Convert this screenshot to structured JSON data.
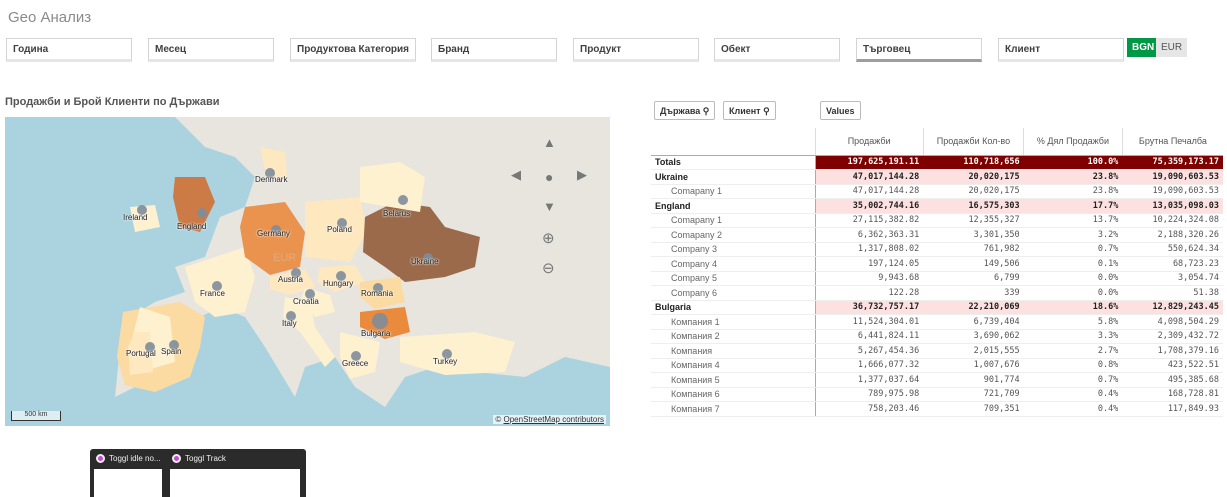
{
  "app": {
    "title": "Geo Анализ"
  },
  "filters": [
    "Година",
    "Месец",
    "Продуктова Категория",
    "Бранд",
    "Продукт",
    "Обект",
    "Търговец",
    "Клиент"
  ],
  "currency": {
    "bgn": "BGN",
    "eur": "EUR"
  },
  "map": {
    "title": "Продажби и Брой Клиенти по Държави",
    "scale": "500 km",
    "attribution_prefix": "©",
    "attribution_link": "OpenStreetMap contributors",
    "watermark": "EUR",
    "countries": [
      "Denmark",
      "Ireland",
      "England",
      "Germany",
      "Poland",
      "Belarus",
      "Ukraine",
      "Austria",
      "Hungary",
      "Romania",
      "France",
      "Croatia",
      "Italy",
      "Bulgaria",
      "Portugal",
      "Spain",
      "Greece",
      "Turkey"
    ]
  },
  "table": {
    "dims": [
      "Държава",
      "Клиент"
    ],
    "values_btn": "Values",
    "headers": [
      "Продажби",
      "Продажби Кол-во",
      "% Дял Продажби",
      "Брутна Печалба"
    ],
    "rows": [
      {
        "type": "tot",
        "cells": [
          "Totals",
          "197,625,191.11",
          "110,718,656",
          "100.0%",
          "75,359,173.17"
        ]
      },
      {
        "type": "grp",
        "cells": [
          "Ukraine",
          "47,017,144.28",
          "20,020,175",
          "23.8%",
          "19,090,603.53"
        ]
      },
      {
        "type": "sub",
        "cells": [
          "Comapany 1",
          "47,017,144.28",
          "20,020,175",
          "23.8%",
          "19,090,603.53"
        ]
      },
      {
        "type": "grp",
        "cells": [
          "England",
          "35,002,744.16",
          "16,575,303",
          "17.7%",
          "13,035,098.03"
        ]
      },
      {
        "type": "sub",
        "cells": [
          "Comapany 1",
          "27,115,382.82",
          "12,355,327",
          "13.7%",
          "10,224,324.08"
        ]
      },
      {
        "type": "sub",
        "cells": [
          "Comapany 2",
          "6,362,363.31",
          "3,301,350",
          "3.2%",
          "2,188,320.26"
        ]
      },
      {
        "type": "sub",
        "cells": [
          "Company 3",
          "1,317,808.02",
          "761,982",
          "0.7%",
          "550,624.34"
        ]
      },
      {
        "type": "sub",
        "cells": [
          "Company 4",
          "197,124.05",
          "149,506",
          "0.1%",
          "68,723.23"
        ]
      },
      {
        "type": "sub",
        "cells": [
          "Company 5",
          "9,943.68",
          "6,799",
          "0.0%",
          "3,054.74"
        ]
      },
      {
        "type": "sub",
        "cells": [
          "Company 6",
          "122.28",
          "339",
          "0.0%",
          "51.38"
        ]
      },
      {
        "type": "grp",
        "cells": [
          "Bulgaria",
          "36,732,757.17",
          "22,210,069",
          "18.6%",
          "12,829,243.45"
        ]
      },
      {
        "type": "sub",
        "cells": [
          "Компания 1",
          "11,524,304.01",
          "6,739,404",
          "5.8%",
          "4,098,504.29"
        ]
      },
      {
        "type": "sub",
        "cells": [
          "Компания 2",
          "6,441,824.11",
          "3,690,062",
          "3.3%",
          "2,309,432.72"
        ]
      },
      {
        "type": "sub",
        "cells": [
          "Компания",
          "5,267,454.36",
          "2,015,555",
          "2.7%",
          "1,708,379.16"
        ]
      },
      {
        "type": "sub",
        "cells": [
          "Компания 4",
          "1,666,077.32",
          "1,007,676",
          "0.8%",
          "423,522.51"
        ]
      },
      {
        "type": "sub",
        "cells": [
          "Компания 5",
          "1,377,037.64",
          "901,774",
          "0.7%",
          "495,385.68"
        ]
      },
      {
        "type": "sub",
        "cells": [
          "Компания 6",
          "789,975.98",
          "721,709",
          "0.4%",
          "168,728.81"
        ]
      },
      {
        "type": "sub",
        "cells": [
          "Компания 7",
          "758,203.46",
          "709,351",
          "0.4%",
          "117,849.93"
        ]
      }
    ]
  },
  "taskbar": {
    "item1": "Toggl idle no...",
    "item2": "Toggl Track"
  }
}
